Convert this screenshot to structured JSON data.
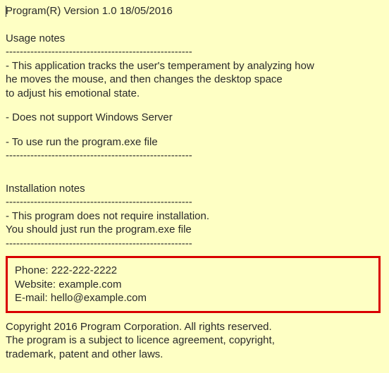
{
  "header": "Program(R) Version 1.0 18/05/2016",
  "usage": {
    "title": "Usage notes",
    "rule": "-----------------------------------------------------",
    "item1a": "- This application tracks the user's temperament by analyzing how",
    "item1b": "he moves the mouse, and then changes the desktop space",
    "item1c": "to adjust his emotional state.",
    "item2": "- Does not support Windows Server",
    "item3": "- To use run the program.exe file",
    "rule_end": "-----------------------------------------------------"
  },
  "install": {
    "title": "Installation notes",
    "rule": "-----------------------------------------------------",
    "line1": "- This program does not require installation.",
    "line2": "You should just run the program.exe file",
    "rule_end": "-----------------------------------------------------"
  },
  "contact": {
    "phone": "Phone: 222-222-2222",
    "website": "Website: example.com",
    "email": "E-mail: hello@example.com"
  },
  "copyright": {
    "l1": "Copyright 2016 Program Corporation. All rights reserved.",
    "l2": "The program is a subject to licence agreement, copyright,",
    "l3": "trademark, patent and other laws."
  }
}
